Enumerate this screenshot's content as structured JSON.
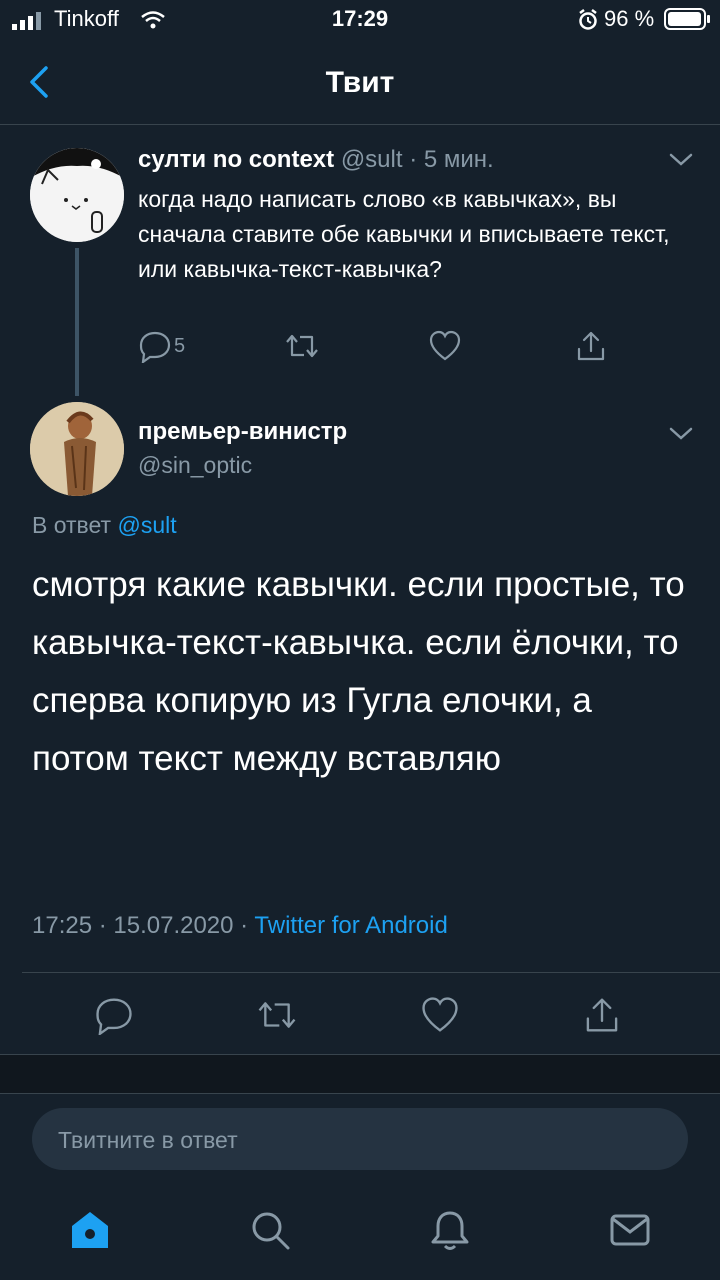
{
  "status_bar": {
    "carrier": "Tinkoff",
    "time": "17:29",
    "battery": "96 %"
  },
  "header": {
    "title": "Твит",
    "back_icon": "chevron-left-icon"
  },
  "reply_tweet": {
    "display_name": "султи no context",
    "handle": "@sult",
    "sep": " · ",
    "age": "5 мин.",
    "text": "когда надо написать слово «в кавычках», вы сначала ставите обе кавычки и вписываете текст, или кавычка-текст-кавычка?",
    "reply_count": "5",
    "icons": [
      "reply-icon",
      "retweet-icon",
      "like-icon",
      "share-icon"
    ]
  },
  "main_tweet": {
    "display_name": "премьер-винистр",
    "handle": "@sin_optic",
    "reply_prefix": "В ответ ",
    "reply_target": "@sult",
    "text": "смотря какие кавычки. если простые, то кавычка-текст-кавычка. если ёлочки, то сперва копирую из Гугла елочки, а потом текст между вставляю",
    "timestamp": "17:25 · 15.07.2020 · ",
    "source": "Twitter for Android"
  },
  "reply_box": {
    "placeholder": "Твитните в ответ"
  },
  "tab_bar": {
    "icons": [
      "home-icon",
      "search-icon",
      "notifications-icon",
      "messages-icon"
    ]
  },
  "colors": {
    "background": "#15202b",
    "accent": "#1da1f2",
    "secondary_text": "#8899a6",
    "divider": "#38444d"
  }
}
